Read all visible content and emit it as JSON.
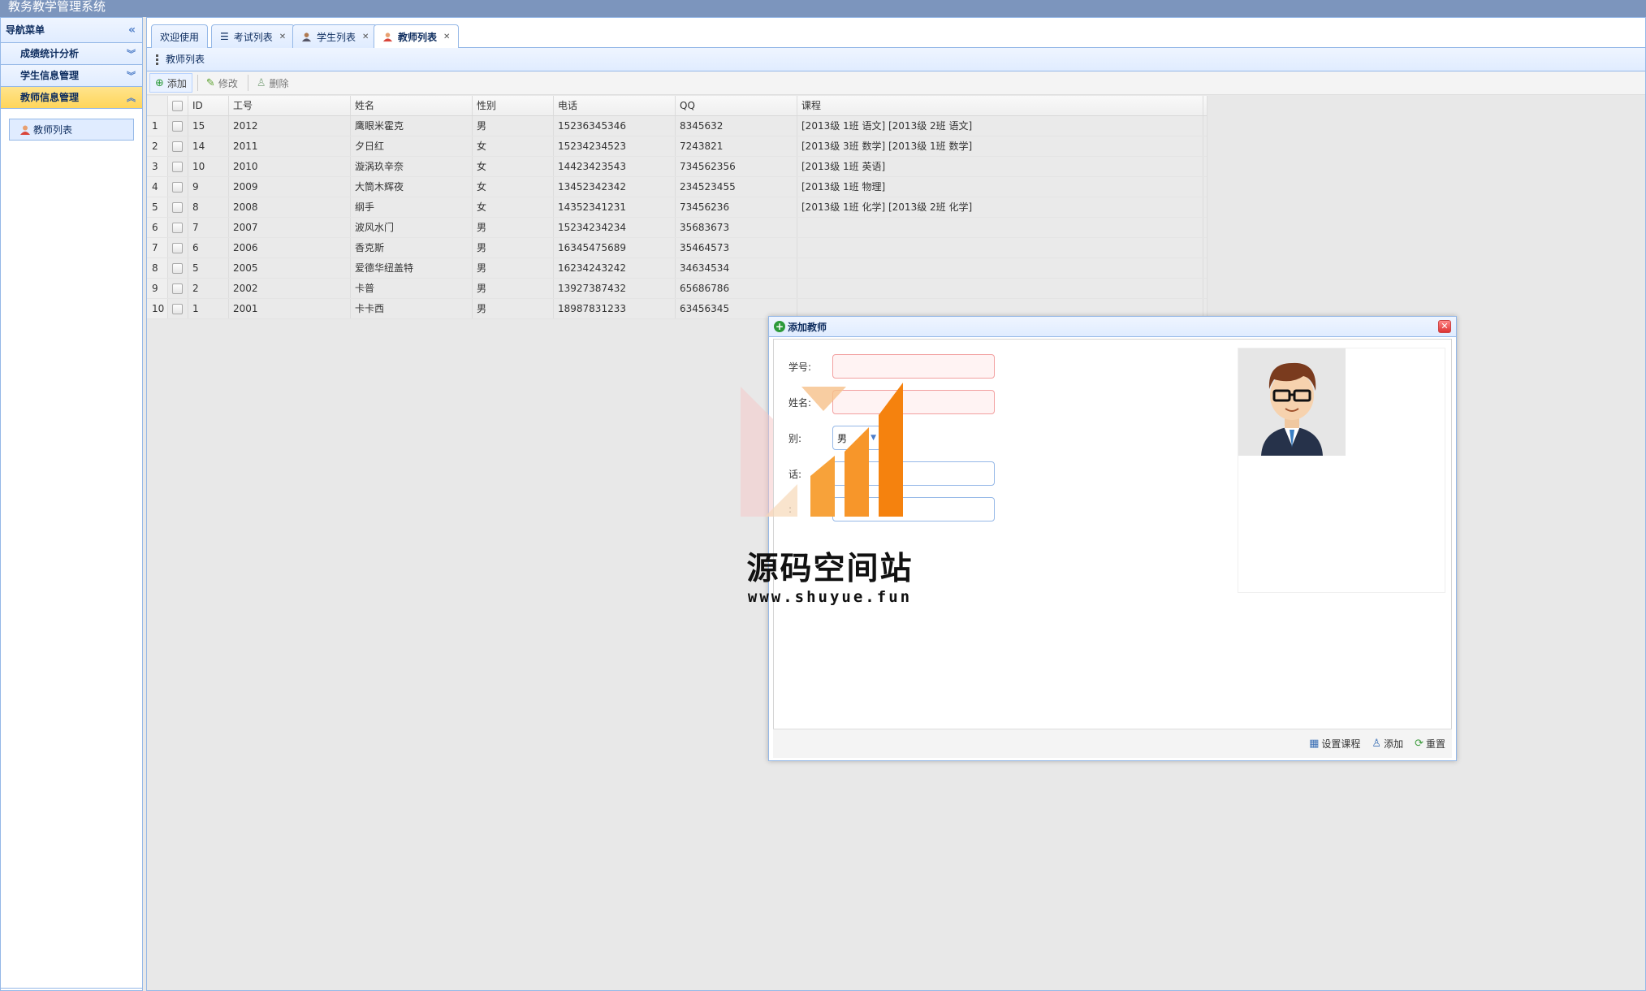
{
  "app": {
    "title": "教务教学管理系统"
  },
  "sidebar": {
    "title": "导航菜单",
    "groups": [
      {
        "label": "成绩统计分析"
      },
      {
        "label": "学生信息管理"
      },
      {
        "label": "教师信息管理"
      }
    ],
    "active_item": "教师列表"
  },
  "tabs": [
    {
      "label": "欢迎使用"
    },
    {
      "label": "考试列表"
    },
    {
      "label": "学生列表"
    },
    {
      "label": "教师列表"
    }
  ],
  "panel": {
    "title": "教师列表"
  },
  "toolbar": {
    "add": "添加",
    "edit": "修改",
    "delete": "删除"
  },
  "grid": {
    "columns": [
      "ID",
      "工号",
      "姓名",
      "性别",
      "电话",
      "QQ",
      "课程"
    ],
    "rows": [
      {
        "num": "1",
        "id": "15",
        "no": "2012",
        "name": "鹰眼米霍克",
        "gender": "男",
        "tel": "15236345346",
        "qq": "8345632",
        "course": "[2013级 1班 语文]   [2013级 2班 语文]"
      },
      {
        "num": "2",
        "id": "14",
        "no": "2011",
        "name": "夕日红",
        "gender": "女",
        "tel": "15234234523",
        "qq": "7243821",
        "course": "[2013级 3班 数学]   [2013级 1班 数学]"
      },
      {
        "num": "3",
        "id": "10",
        "no": "2010",
        "name": "漩涡玖辛奈",
        "gender": "女",
        "tel": "14423423543",
        "qq": "734562356",
        "course": "[2013级 1班 英语]"
      },
      {
        "num": "4",
        "id": "9",
        "no": "2009",
        "name": "大筒木辉夜",
        "gender": "女",
        "tel": "13452342342",
        "qq": "234523455",
        "course": "[2013级 1班 物理]"
      },
      {
        "num": "5",
        "id": "8",
        "no": "2008",
        "name": "纲手",
        "gender": "女",
        "tel": "14352341231",
        "qq": "73456236",
        "course": "[2013级 1班 化学]   [2013级 2班 化学]"
      },
      {
        "num": "6",
        "id": "7",
        "no": "2007",
        "name": "波风水门",
        "gender": "男",
        "tel": "15234234234",
        "qq": "35683673",
        "course": ""
      },
      {
        "num": "7",
        "id": "6",
        "no": "2006",
        "name": "香克斯",
        "gender": "男",
        "tel": "16345475689",
        "qq": "35464573",
        "course": ""
      },
      {
        "num": "8",
        "id": "5",
        "no": "2005",
        "name": "爱德华纽盖特",
        "gender": "男",
        "tel": "16234243242",
        "qq": "34634534",
        "course": ""
      },
      {
        "num": "9",
        "id": "2",
        "no": "2002",
        "name": "卡普",
        "gender": "男",
        "tel": "13927387432",
        "qq": "65686786",
        "course": ""
      },
      {
        "num": "10",
        "id": "1",
        "no": "2001",
        "name": "卡卡西",
        "gender": "男",
        "tel": "18987831233",
        "qq": "63456345",
        "course": ""
      }
    ]
  },
  "dialog": {
    "title": "添加教师",
    "fields": {
      "number_label": "学号:",
      "name_label": "姓名:",
      "gender_label": "别:",
      "gender_value": "男",
      "phone_label": "话:",
      "qq_label": ":"
    },
    "buttons": {
      "set_course": "设置课程",
      "add": "添加",
      "reset": "重置"
    }
  },
  "watermark": {
    "text": "源码空间站",
    "url": "www.shuyue.fun"
  },
  "colors": {
    "header_bg": "#7c95bd",
    "border": "#95b8e7",
    "accent_active": "#ffd55a"
  }
}
